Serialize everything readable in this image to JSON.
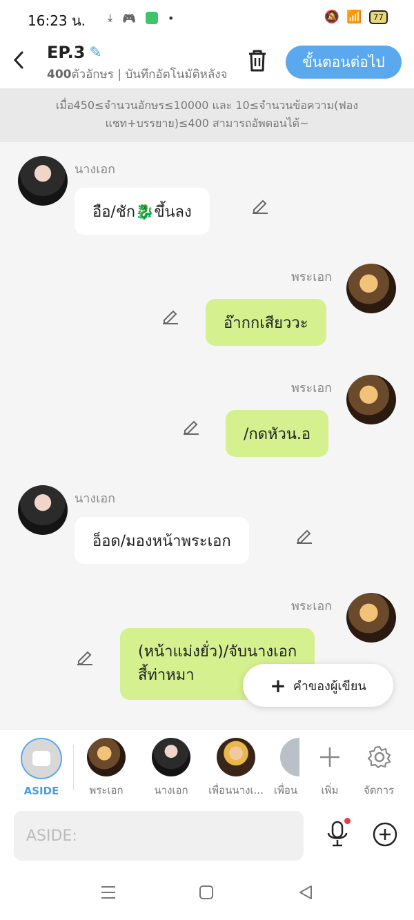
{
  "status_bar": {
    "time": "16:23 น.",
    "battery": "77"
  },
  "header": {
    "back_label": "<",
    "title": "EP.3",
    "char_count": "400",
    "subtitle_rest": "ตัวอักษร | บันทึกอัตโนมัติหลังจาก",
    "next_label": "ขั้นตอนต่อไป"
  },
  "notice": {
    "line1": "เมื่อ450≤จำนวนอักษร≤10000 และ 10≤จำนวนข้อความ(ฟอง",
    "line2": "แชท+บรรยาย)≤400 สามารถอัพตอนได้~"
  },
  "messages": [
    {
      "name": "นางเอก",
      "text": "อือ/ชัก🐉ขึ้นลง"
    },
    {
      "name": "พระเอก",
      "text": "อ๊ากกเสียววะ"
    },
    {
      "name": "พระเอก",
      "text": "/กดหัวน.อ"
    },
    {
      "name": "นางเอก",
      "text": "อ็อด/มองหน้าพระเอก"
    },
    {
      "name": "พระเอก",
      "text_line1": "(หน้าแม่งยั่ว)/จับนางเอก",
      "text_line2": "สี้ท่าหมา"
    }
  ],
  "writer_button": "คำของผู้เขียน",
  "characters": [
    {
      "label": "ASIDE"
    },
    {
      "label": "พระเอก"
    },
    {
      "label": "นางเอก"
    },
    {
      "label": "เพื่อนนางเ..."
    },
    {
      "label": "เพื่อน"
    }
  ],
  "actions": {
    "add_label": "เพิ่ม",
    "manage_label": "จัดการ"
  },
  "input": {
    "placeholder": "ASIDE:"
  },
  "icons": {
    "edit": "pencil-icon",
    "trash": "trash-icon",
    "mic": "microphone-icon",
    "add": "plus-circle-icon",
    "settings": "gear-icon"
  },
  "colors": {
    "accent": "#5aa9ee",
    "bubble_right": "#d5f08f",
    "bubble_left": "#ffffff"
  }
}
